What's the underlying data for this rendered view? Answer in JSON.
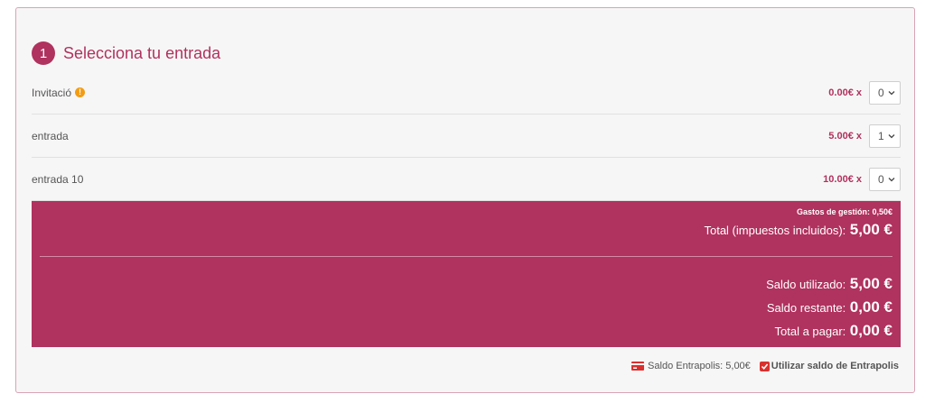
{
  "step": {
    "number": "1",
    "title": "Selecciona tu entrada"
  },
  "tickets": [
    {
      "name": "Invitació",
      "price": "0.00€ x",
      "quantity": "0",
      "has_info": true
    },
    {
      "name": "entrada",
      "price": "5.00€ x",
      "quantity": "1",
      "has_info": false
    },
    {
      "name": "entrada 10",
      "price": "10.00€ x",
      "quantity": "0",
      "has_info": false
    }
  ],
  "summary": {
    "fees": "Gastos de gestión: 0,50€",
    "total_label": "Total (impuestos incluidos):",
    "total_value": "5,00 €",
    "used_label": "Saldo utilizado:",
    "used_value": "5,00 €",
    "remaining_label": "Saldo restante:",
    "remaining_value": "0,00 €",
    "to_pay_label": "Total a pagar:",
    "to_pay_value": "0,00 €"
  },
  "footer": {
    "balance_text": "Saldo Entrapolis: 5,00€",
    "use_balance_label": "Utilizar saldo de Entrapolis",
    "use_balance_checked": true
  },
  "colors": {
    "accent": "#b0325e",
    "info": "#f39c12",
    "checkbox": "#d9302e"
  }
}
